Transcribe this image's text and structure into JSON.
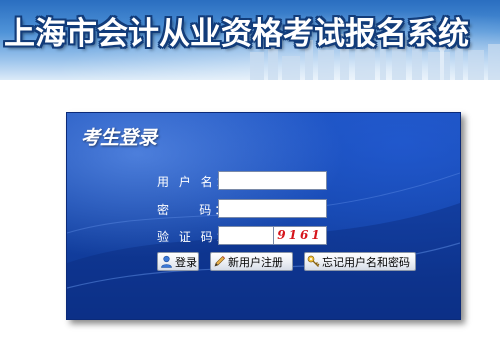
{
  "header": {
    "title": "上海市会计从业资格考试报名系统"
  },
  "login": {
    "title": "考生登录",
    "username_label": "用 户 名：",
    "username_value": "",
    "password_label": "密    码：",
    "password_value": "",
    "captcha_label": "验 证 码：",
    "captcha_value": "",
    "captcha_code": "9161"
  },
  "buttons": {
    "login_label": "登录",
    "register_label": "新用户注册",
    "forgot_label": "忘记用户名和密码"
  },
  "icons": {
    "login": "user-icon",
    "register": "pencil-icon",
    "forgot": "key-icon"
  },
  "colors": {
    "panel_blue": "#1444a8",
    "captcha_red": "#d6141a",
    "title_outline": "#123c7a"
  }
}
